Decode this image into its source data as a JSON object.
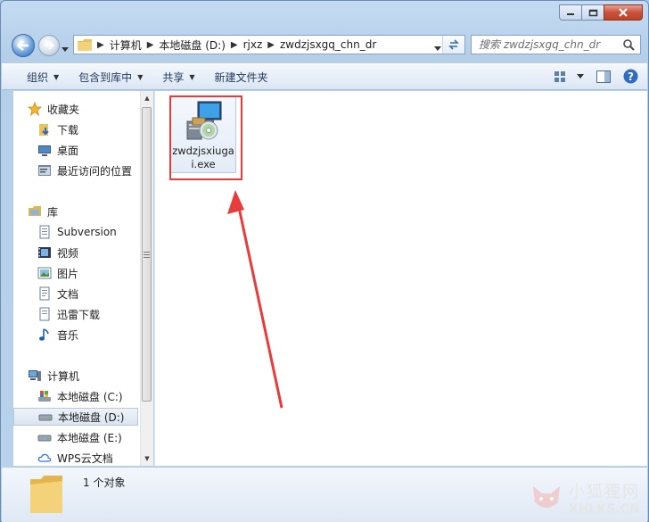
{
  "window": {
    "caption": {
      "min": "minimize-icon",
      "max": "maximize-icon",
      "close": "close-icon"
    }
  },
  "address": {
    "crumbs": [
      "计算机",
      "本地磁盘 (D:)",
      "rjxz",
      "zwdzjsxgq_chn_dr"
    ]
  },
  "search": {
    "placeholder": "搜索 zwdzjsxgq_chn_dr"
  },
  "toolbar": {
    "organize": "组织",
    "include_in_library": "包含到库中",
    "share": "共享",
    "new_folder": "新建文件夹"
  },
  "nav": {
    "favorites": {
      "label": "收藏夹",
      "items": [
        "下载",
        "桌面",
        "最近访问的位置"
      ]
    },
    "libraries": {
      "label": "库",
      "items": [
        "Subversion",
        "视频",
        "图片",
        "文档",
        "迅雷下载",
        "音乐"
      ]
    },
    "computer": {
      "label": "计算机",
      "items": [
        "本地磁盘 (C:)",
        "本地磁盘 (D:)",
        "本地磁盘 (E:)",
        "WPS云文档"
      ]
    },
    "selected": "本地磁盘 (D:)"
  },
  "files": [
    {
      "name": "zwdzjsxiugai.exe",
      "icon": "installer-exe-icon"
    }
  ],
  "status": {
    "count_text": "1 个对象"
  },
  "watermark": {
    "cn": "小狐狸网",
    "en": "XHLKS.CN"
  },
  "colors": {
    "highlight": "#e83b3b",
    "arrow": "#e83b3b"
  }
}
